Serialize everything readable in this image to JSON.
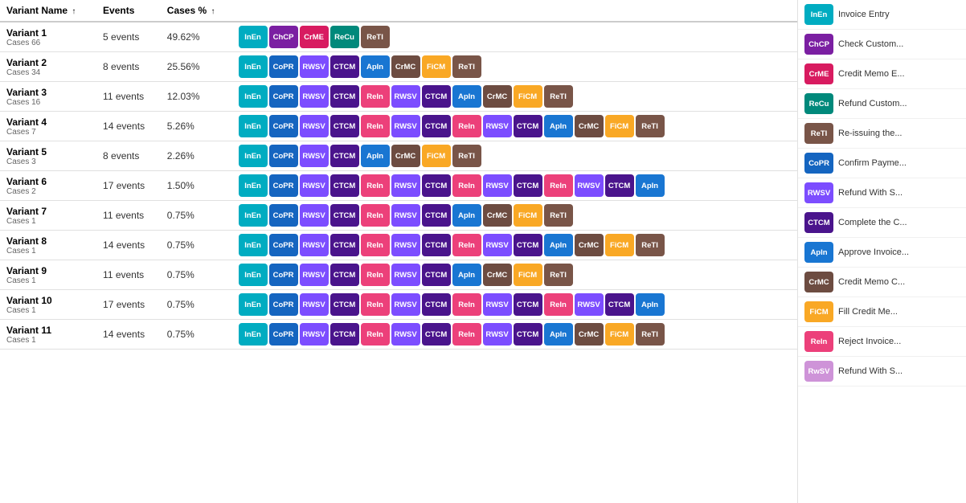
{
  "colors": {
    "InEn": "#00ACC1",
    "ChCP": "#7B1FA2",
    "CrME": "#E91E8C",
    "ReCu": "#00897B",
    "ReTI": "#8D6E63",
    "CoPR": "#1565C0",
    "RWSV": "#7C4DFF",
    "CTCM": "#6A1B9A",
    "ApIn": "#1976D2",
    "CrMC": "#8D6E63",
    "FiCM": "#F9A825",
    "ReIn": "#EC407A",
    "RwSV2": "#CE93D8"
  },
  "headers": {
    "variant_name": "Variant Name",
    "events": "Events",
    "cases_pct": "Cases %",
    "sort_up": "↑"
  },
  "variants": [
    {
      "name": "Variant 1",
      "cases": "Cases 66",
      "events": "5 events",
      "cases_pct": "49.62%",
      "activities": [
        "InEn",
        "ChCP",
        "CrME",
        "ReCu",
        "ReTI"
      ]
    },
    {
      "name": "Variant 2",
      "cases": "Cases 34",
      "events": "8 events",
      "cases_pct": "25.56%",
      "activities": [
        "InEn",
        "CoPR",
        "RWSV",
        "CTCM",
        "ApIn",
        "CrMC",
        "FiCM",
        "ReTI"
      ]
    },
    {
      "name": "Variant 3",
      "cases": "Cases 16",
      "events": "11 events",
      "cases_pct": "12.03%",
      "activities": [
        "InEn",
        "CoPR",
        "RWSV",
        "CTCM",
        "ReIn",
        "RWSV",
        "CTCM",
        "ApIn",
        "CrMC",
        "FiCM",
        "ReTI"
      ]
    },
    {
      "name": "Variant 4",
      "cases": "Cases 7",
      "events": "14 events",
      "cases_pct": "5.26%",
      "activities": [
        "InEn",
        "CoPR",
        "RWSV",
        "CTCM",
        "ReIn",
        "RWSV",
        "CTCM",
        "ReIn",
        "RWSV",
        "CTCM",
        "ApIn",
        "CrMC",
        "FiCM",
        "ReTI"
      ]
    },
    {
      "name": "Variant 5",
      "cases": "Cases 3",
      "events": "8 events",
      "cases_pct": "2.26%",
      "activities": [
        "InEn",
        "CoPR",
        "RWSV",
        "CTCM",
        "ApIn",
        "CrMC",
        "FiCM",
        "ReTI"
      ]
    },
    {
      "name": "Variant 6",
      "cases": "Cases 2",
      "events": "17 events",
      "cases_pct": "1.50%",
      "activities": [
        "InEn",
        "CoPR",
        "RWSV",
        "CTCM",
        "ReIn",
        "RWSV",
        "CTCM",
        "ReIn",
        "RWSV",
        "CTCM",
        "ReIn",
        "RWSV",
        "CTCM",
        "ApIn"
      ]
    },
    {
      "name": "Variant 7",
      "cases": "Cases 1",
      "events": "11 events",
      "cases_pct": "0.75%",
      "activities": [
        "InEn",
        "CoPR",
        "RWSV",
        "CTCM",
        "ReIn",
        "RWSV",
        "CTCM",
        "ApIn",
        "CrMC",
        "FiCM",
        "ReTI"
      ]
    },
    {
      "name": "Variant 8",
      "cases": "Cases 1",
      "events": "14 events",
      "cases_pct": "0.75%",
      "activities": [
        "InEn",
        "CoPR",
        "RWSV",
        "CTCM",
        "ReIn",
        "RWSV",
        "CTCM",
        "ReIn",
        "RWSV",
        "CTCM",
        "ApIn",
        "CrMC",
        "FiCM",
        "ReTI"
      ]
    },
    {
      "name": "Variant 9",
      "cases": "Cases 1",
      "events": "11 events",
      "cases_pct": "0.75%",
      "activities": [
        "InEn",
        "CoPR",
        "RWSV",
        "CTCM",
        "ReIn",
        "RWSV",
        "CTCM",
        "ApIn",
        "CrMC",
        "FiCM",
        "ReTI"
      ]
    },
    {
      "name": "Variant 10",
      "cases": "Cases 1",
      "events": "17 events",
      "cases_pct": "0.75%",
      "activities": [
        "InEn",
        "CoPR",
        "RWSV",
        "CTCM",
        "ReIn",
        "RWSV",
        "CTCM",
        "ReIn",
        "RWSV",
        "CTCM",
        "ReIn",
        "RWSV",
        "CTCM",
        "ApIn"
      ]
    },
    {
      "name": "Variant 11",
      "cases": "Cases 1",
      "events": "14 events",
      "cases_pct": "0.75%",
      "activities": [
        "InEn",
        "CoPR",
        "RWSV",
        "CTCM",
        "ReIn",
        "RWSV",
        "CTCM",
        "ReIn",
        "RWSV",
        "CTCM",
        "ApIn",
        "CrMC",
        "FiCM",
        "ReTI"
      ]
    }
  ],
  "legend": [
    {
      "code": "InEn",
      "label": "Invoice Entry"
    },
    {
      "code": "ChCP",
      "label": "Check Custom..."
    },
    {
      "code": "CrME",
      "label": "Credit Memo E..."
    },
    {
      "code": "ReCu",
      "label": "Refund Custom..."
    },
    {
      "code": "ReTI",
      "label": "Re-issuing the..."
    },
    {
      "code": "CoPR",
      "label": "Confirm Payme..."
    },
    {
      "code": "RWSV",
      "label": "Refund With S..."
    },
    {
      "code": "CTCM",
      "label": "Complete the C..."
    },
    {
      "code": "ApIn",
      "label": "Approve Invoice..."
    },
    {
      "code": "CrMC",
      "label": "Credit Memo C..."
    },
    {
      "code": "FiCM",
      "label": "Fill Credit Me..."
    },
    {
      "code": "ReIn",
      "label": "Reject Invoice..."
    },
    {
      "code": "RwSV",
      "label": "Refund With S..."
    }
  ],
  "activity_colors": {
    "InEn": "#00ACC1",
    "ChCP": "#7B1FA2",
    "CrME": "#D81B60",
    "ReCu": "#00897B",
    "ReTI": "#795548",
    "CoPR": "#1565C0",
    "RWSV": "#7C4DFF",
    "CTCM": "#4A148C",
    "ApIn": "#1976D2",
    "CrMC": "#6D4C41",
    "FiCM": "#F9A825",
    "ReIn": "#EC407A",
    "RwSV": "#CE93D8"
  }
}
